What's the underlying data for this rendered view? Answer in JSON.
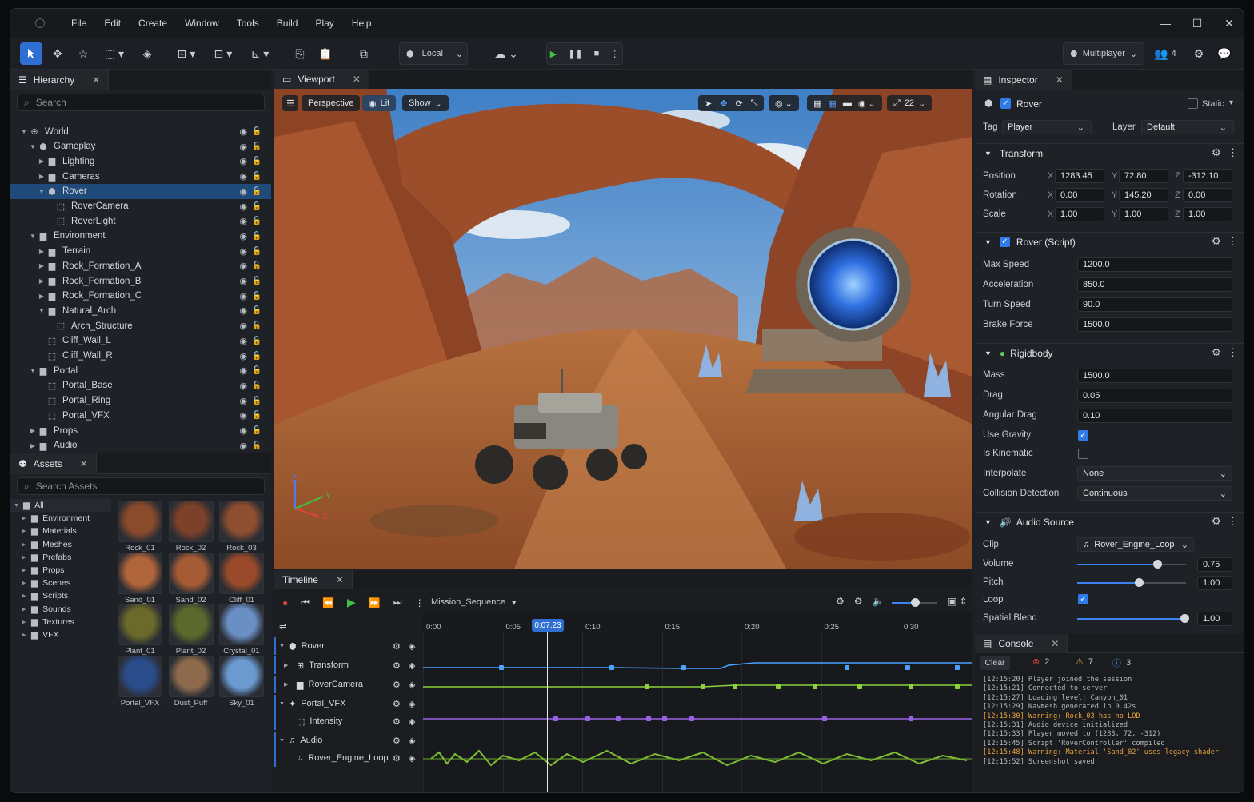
{
  "menu": [
    "File",
    "Edit",
    "Create",
    "Window",
    "Tools",
    "Build",
    "Play",
    "Help"
  ],
  "window_controls": {
    "min": "—",
    "max": "☐",
    "close": "✕"
  },
  "toolbar": {
    "space_label": "Local",
    "multiplayer_label": "Multiplayer",
    "users_count": "4"
  },
  "hierarchy": {
    "tab": "Hierarchy",
    "search_placeholder": "Search",
    "items": [
      {
        "label": "World",
        "depth": 0,
        "arrow": "▼",
        "icon": "world"
      },
      {
        "label": "Gameplay",
        "depth": 1,
        "arrow": "▼",
        "icon": "cube"
      },
      {
        "label": "Lighting",
        "depth": 2,
        "arrow": "▶",
        "icon": "folder"
      },
      {
        "label": "Cameras",
        "depth": 2,
        "arrow": "▶",
        "icon": "folder"
      },
      {
        "label": "Rover",
        "depth": 2,
        "arrow": "▼",
        "icon": "cube",
        "selected": true
      },
      {
        "label": "RoverCamera",
        "depth": 3,
        "arrow": "",
        "icon": "object"
      },
      {
        "label": "RoverLight",
        "depth": 3,
        "arrow": "",
        "icon": "object"
      },
      {
        "label": "Environment",
        "depth": 1,
        "arrow": "▼",
        "icon": "folder"
      },
      {
        "label": "Terrain",
        "depth": 2,
        "arrow": "▶",
        "icon": "folder"
      },
      {
        "label": "Rock_Formation_A",
        "depth": 2,
        "arrow": "▶",
        "icon": "folder"
      },
      {
        "label": "Rock_Formation_B",
        "depth": 2,
        "arrow": "▶",
        "icon": "folder"
      },
      {
        "label": "Rock_Formation_C",
        "depth": 2,
        "arrow": "▶",
        "icon": "folder"
      },
      {
        "label": "Natural_Arch",
        "depth": 2,
        "arrow": "▼",
        "icon": "folder"
      },
      {
        "label": "Arch_Structure",
        "depth": 3,
        "arrow": "",
        "icon": "object"
      },
      {
        "label": "Cliff_Wall_L",
        "depth": 2,
        "arrow": "",
        "icon": "object"
      },
      {
        "label": "Cliff_Wall_R",
        "depth": 2,
        "arrow": "",
        "icon": "object"
      },
      {
        "label": "Portal",
        "depth": 1,
        "arrow": "▼",
        "icon": "folder"
      },
      {
        "label": "Portal_Base",
        "depth": 2,
        "arrow": "",
        "icon": "object"
      },
      {
        "label": "Portal_Ring",
        "depth": 2,
        "arrow": "",
        "icon": "object"
      },
      {
        "label": "Portal_VFX",
        "depth": 2,
        "arrow": "",
        "icon": "object"
      },
      {
        "label": "Props",
        "depth": 1,
        "arrow": "▶",
        "icon": "folder"
      },
      {
        "label": "Audio",
        "depth": 1,
        "arrow": "▶",
        "icon": "folder"
      }
    ]
  },
  "assets": {
    "tab": "Assets",
    "search_placeholder": "Search Assets",
    "folders": [
      "All",
      "Environment",
      "Materials",
      "Meshes",
      "Prefabs",
      "Props",
      "Scenes",
      "Scripts",
      "Sounds",
      "Textures",
      "VFX"
    ],
    "items": [
      {
        "label": "Rock_01",
        "color": "#8a4a2c"
      },
      {
        "label": "Rock_02",
        "color": "#7d4028"
      },
      {
        "label": "Rock_03",
        "color": "#8e4e30"
      },
      {
        "label": "Sand_01",
        "color": "#b0643a"
      },
      {
        "label": "Sand_02",
        "color": "#a55c34"
      },
      {
        "label": "Cliff_01",
        "color": "#9a4a2a"
      },
      {
        "label": "Plant_01",
        "color": "#6b6a2a"
      },
      {
        "label": "Plant_02",
        "color": "#5b6a2c"
      },
      {
        "label": "Crystal_01",
        "color": "#6a8fc4"
      },
      {
        "label": "Portal_VFX",
        "color": "#2a4c8a"
      },
      {
        "label": "Dust_Puff",
        "color": "#8e6a4c"
      },
      {
        "label": "Sky_01",
        "color": "#6a9ad0"
      }
    ]
  },
  "viewport": {
    "tab": "Viewport",
    "perspective": "Perspective",
    "lit": "Lit",
    "show": "Show",
    "snap_value": "22",
    "axes": {
      "z": "Z",
      "y": "Y",
      "x": "X"
    }
  },
  "inspector": {
    "tab": "Inspector",
    "object_name": "Rover",
    "static_label": "Static",
    "tag_label": "Tag",
    "tag_value": "Player",
    "layer_label": "Layer",
    "layer_value": "Default",
    "transform": {
      "title": "Transform",
      "rows": [
        {
          "label": "Position",
          "x": "1283.45",
          "y": "72.80",
          "z": "-312.10"
        },
        {
          "label": "Rotation",
          "x": "0.00",
          "y": "145.20",
          "z": "0.00"
        },
        {
          "label": "Scale",
          "x": "1.00",
          "y": "1.00",
          "z": "1.00"
        }
      ]
    },
    "script": {
      "title": "Rover (Script)",
      "rows": [
        {
          "label": "Max Speed",
          "value": "1200.0"
        },
        {
          "label": "Acceleration",
          "value": "850.0"
        },
        {
          "label": "Turn Speed",
          "value": "90.0"
        },
        {
          "label": "Brake Force",
          "value": "1500.0"
        }
      ]
    },
    "rigidbody": {
      "title": "Rigidbody",
      "mass_label": "Mass",
      "mass": "1500.0",
      "drag_label": "Drag",
      "drag": "0.05",
      "angular_label": "Angular Drag",
      "angular": "0.10",
      "gravity_label": "Use Gravity",
      "gravity": true,
      "kinematic_label": "Is Kinematic",
      "kinematic": false,
      "interp_label": "Interpolate",
      "interp": "None",
      "collision_label": "Collision Detection",
      "collision": "Continuous"
    },
    "audio": {
      "title": "Audio Source",
      "clip_label": "Clip",
      "clip": "Rover_Engine_Loop",
      "volume_label": "Volume",
      "volume": "0.75",
      "pitch_label": "Pitch",
      "pitch": "1.00",
      "loop_label": "Loop",
      "loop": true,
      "blend_label": "Spatial Blend",
      "blend": "1.00"
    }
  },
  "timeline": {
    "tab": "Timeline",
    "sequence": "Mission_Sequence",
    "current_time": "0:07.23",
    "ticks": [
      "0:00",
      "0:05",
      "0:10",
      "0:15",
      "0:20",
      "0:25",
      "0:30"
    ],
    "tracks": [
      {
        "label": "Rover",
        "level": 0,
        "icon": "cube"
      },
      {
        "label": "Transform",
        "level": 1,
        "icon": "transform"
      },
      {
        "label": "RoverCamera",
        "level": 1,
        "icon": "folder"
      },
      {
        "label": "Portal_VFX",
        "level": 0,
        "icon": "vfx"
      },
      {
        "label": "Intensity",
        "level": 1,
        "icon": "param"
      },
      {
        "label": "Audio",
        "level": 0,
        "icon": "note"
      },
      {
        "label": "Rover_Engine_Loop",
        "level": 1,
        "icon": "note"
      }
    ]
  },
  "console": {
    "tab": "Console",
    "clear": "Clear",
    "errors": "2",
    "warnings": "7",
    "infos": "3",
    "lines": [
      {
        "text": "[12:15:20] Player joined the session",
        "warn": false
      },
      {
        "text": "[12:15:21] Connected to server",
        "warn": false
      },
      {
        "text": "[12:15:27] Loading level: Canyon_01",
        "warn": false
      },
      {
        "text": "[12:15:29] Navmesh generated in 0.42s",
        "warn": false
      },
      {
        "text": "[12:15:30] Warning: Rock_03 has no LOD",
        "warn": true
      },
      {
        "text": "[12:15:31] Audio device initialized",
        "warn": false
      },
      {
        "text": "[12:15:33] Player moved to (1283, 72, -312)",
        "warn": false
      },
      {
        "text": "[12:15:45] Script 'RoverController' compiled",
        "warn": false
      },
      {
        "text": "[12:15:48] Warning: Material 'Sand_02' uses legacy shader",
        "warn": true
      },
      {
        "text": "[12:15:52] Screenshot saved",
        "warn": false
      }
    ]
  }
}
